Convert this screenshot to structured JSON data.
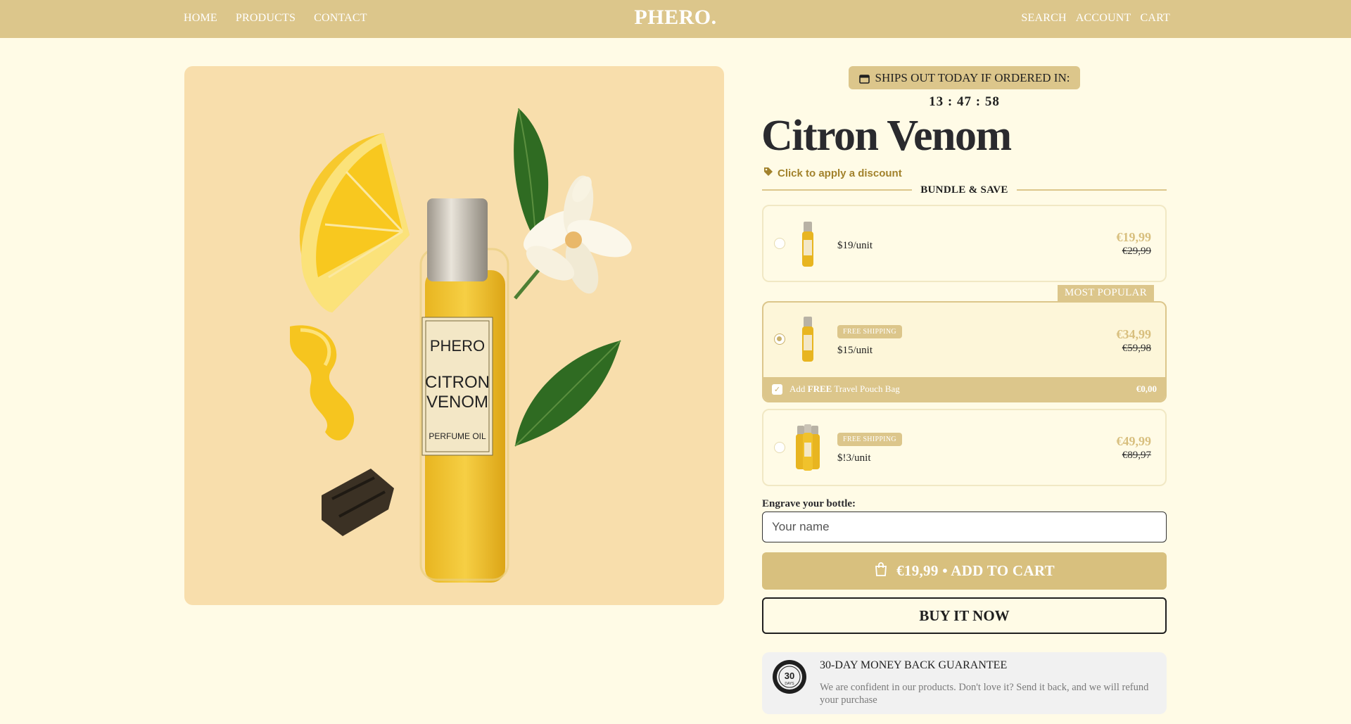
{
  "header": {
    "nav_left": [
      "HOME",
      "PRODUCTS",
      "CONTACT"
    ],
    "logo": "PHERO.",
    "nav_right": [
      "SEARCH",
      "ACCOUNT",
      "CART"
    ]
  },
  "product_image": {
    "bottle_brand": "PHERO",
    "bottle_name_line1": "CITRON",
    "bottle_name_line2": "VENOM",
    "bottle_type": "PERFUME OIL"
  },
  "shipping": {
    "label": "SHIPS OUT TODAY IF ORDERED IN:",
    "timer": "13 : 47 : 58"
  },
  "product": {
    "title": "Citron Venom",
    "discount_link": "Click to apply a discount",
    "bundle_heading": "BUNDLE & SAVE"
  },
  "options": [
    {
      "unit_price": "$19/unit",
      "price": "€19,99",
      "compare_price": "€29,99",
      "selected": false
    },
    {
      "unit_price": "$15/unit",
      "price": "€34,99",
      "compare_price": "€59,98",
      "selected": true,
      "badge": "FREE SHIPPING",
      "tag": "MOST POPULAR",
      "addon": {
        "label_prefix": "Add ",
        "label_bold": "FREE",
        "label_suffix": " Travel Pouch Bag",
        "price": "€0,00",
        "checked": true
      }
    },
    {
      "unit_price": "$!3/unit",
      "price": "€49,99",
      "compare_price": "€89,97",
      "selected": false,
      "badge": "FREE SHIPPING"
    }
  ],
  "engrave": {
    "label": "Engrave your bottle:",
    "placeholder": "Your name"
  },
  "cta": {
    "add_to_cart": "€19,99 • ADD TO CART",
    "buy_now": "BUY IT NOW"
  },
  "guarantee": {
    "title": "30-DAY MONEY BACK GUARANTEE",
    "text": "We are confident in our products. Don't love it? Send it back, and we will refund your purchase",
    "badge_number": "30",
    "badge_word": "DAYS"
  },
  "colors": {
    "header": "#dcc68b",
    "background": "#fffbe6",
    "image_bg": "#f8deac",
    "accent_price": "#d8bf7e",
    "discount_text": "#a2822c"
  }
}
